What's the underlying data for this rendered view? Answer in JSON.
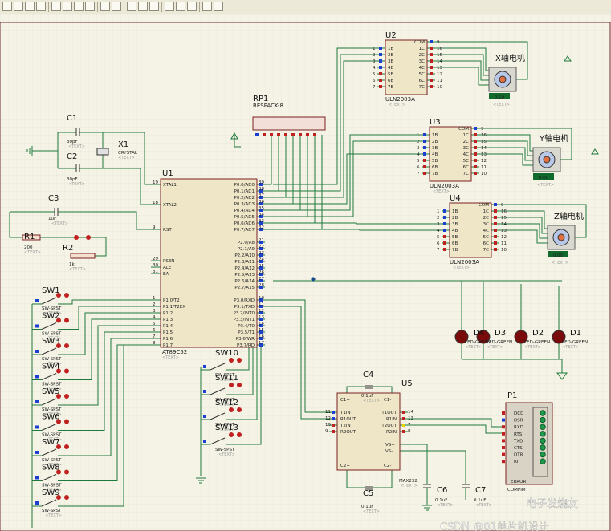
{
  "toolbar": {
    "buttons": [
      "new",
      "open",
      "save",
      "print",
      "zoom-in",
      "zoom-out",
      "zoom-all",
      "pan",
      "undo",
      "redo",
      "cut",
      "copy",
      "paste",
      "find",
      "bom",
      "netlist",
      "library",
      "error-log"
    ]
  },
  "components": {
    "u1": {
      "ref": "U1",
      "type": "AT89C52",
      "text": "<TEXT>",
      "left_pins": [
        {
          "num": "19",
          "name": "XTAL1"
        },
        {
          "num": "18",
          "name": "XTAL2"
        },
        {
          "num": "9",
          "name": "RST"
        },
        {
          "num": "29",
          "name": "PSEN"
        },
        {
          "num": "30",
          "name": "ALE"
        },
        {
          "num": "31",
          "name": "EA"
        },
        {
          "num": "1",
          "name": "P1.0/T2"
        },
        {
          "num": "2",
          "name": "P1.1/T2EX"
        },
        {
          "num": "3",
          "name": "P1.2"
        },
        {
          "num": "4",
          "name": "P1.3"
        },
        {
          "num": "5",
          "name": "P1.4"
        },
        {
          "num": "6",
          "name": "P1.5"
        },
        {
          "num": "7",
          "name": "P1.6"
        },
        {
          "num": "8",
          "name": "P1.7"
        }
      ],
      "right_pins": [
        {
          "num": "39",
          "name": "P0.0/AD0"
        },
        {
          "num": "38",
          "name": "P0.1/AD1"
        },
        {
          "num": "37",
          "name": "P0.2/AD2"
        },
        {
          "num": "36",
          "name": "P0.3/AD3"
        },
        {
          "num": "35",
          "name": "P0.4/AD4"
        },
        {
          "num": "34",
          "name": "P0.5/AD5"
        },
        {
          "num": "33",
          "name": "P0.6/AD6"
        },
        {
          "num": "32",
          "name": "P0.7/AD7"
        },
        {
          "num": "21",
          "name": "P2.0/A8"
        },
        {
          "num": "22",
          "name": "P2.1/A9"
        },
        {
          "num": "23",
          "name": "P2.2/A10"
        },
        {
          "num": "24",
          "name": "P2.3/A11"
        },
        {
          "num": "25",
          "name": "P2.4/A12"
        },
        {
          "num": "26",
          "name": "P2.5/A13"
        },
        {
          "num": "27",
          "name": "P2.6/A14"
        },
        {
          "num": "28",
          "name": "P2.7/A15"
        },
        {
          "num": "10",
          "name": "P3.0/RXD"
        },
        {
          "num": "11",
          "name": "P3.1/TXD"
        },
        {
          "num": "12",
          "name": "P3.2/INT0"
        },
        {
          "num": "13",
          "name": "P3.3/INT1"
        },
        {
          "num": "14",
          "name": "P3.4/T0"
        },
        {
          "num": "15",
          "name": "P3.5/T1"
        },
        {
          "num": "16",
          "name": "P3.6/WR"
        },
        {
          "num": "17",
          "name": "P3.7/RD"
        }
      ]
    },
    "uln": [
      {
        "ref": "U2",
        "type": "ULN2003A",
        "text": "<TEXT>"
      },
      {
        "ref": "U3",
        "type": "ULN2003A",
        "text": "<TEXT>"
      },
      {
        "ref": "U4",
        "type": "ULN2003A",
        "text": "<TEXT>"
      }
    ],
    "uln_left_pins": [
      {
        "num": "1",
        "name": "1B"
      },
      {
        "num": "2",
        "name": "2B"
      },
      {
        "num": "3",
        "name": "3B"
      },
      {
        "num": "4",
        "name": "4B"
      },
      {
        "num": "5",
        "name": "5B"
      },
      {
        "num": "6",
        "name": "6B"
      },
      {
        "num": "7",
        "name": "7B"
      }
    ],
    "uln_right_pins": [
      {
        "num": "9",
        "name": "COM"
      },
      {
        "num": "16",
        "name": "1C"
      },
      {
        "num": "15",
        "name": "2C"
      },
      {
        "num": "14",
        "name": "3C"
      },
      {
        "num": "13",
        "name": "4C"
      },
      {
        "num": "12",
        "name": "5C"
      },
      {
        "num": "11",
        "name": "6C"
      },
      {
        "num": "10",
        "name": "7C"
      }
    ],
    "motors": [
      {
        "label": "X轴电机",
        "readout": "0.10",
        "text": "<TEXT>"
      },
      {
        "label": "Y轴电机",
        "readout": "0.00",
        "text": "<TEXT>"
      },
      {
        "label": "Z轴电机",
        "readout": "0.00",
        "text": "<TEXT>"
      }
    ],
    "rp1": {
      "ref": "RP1",
      "type": "RESPACK-8"
    },
    "c1": {
      "ref": "C1",
      "value": "30pF",
      "text": "<TEXT>"
    },
    "c2": {
      "ref": "C2",
      "value": "30pF",
      "text": "<TEXT>"
    },
    "x1": {
      "ref": "X1",
      "type": "CRYSTAL",
      "text": "<TEXT>"
    },
    "c3": {
      "ref": "C3",
      "value": "1uF",
      "text": "<TEXT>"
    },
    "r1": {
      "ref": "R1",
      "value": "200",
      "text": "<TEXT>"
    },
    "r2": {
      "ref": "R2",
      "value": "1k",
      "text": "<TEXT>"
    },
    "switches_left": [
      {
        "ref": "SW1",
        "type": "SW-SPST",
        "text": "<TEXT>"
      },
      {
        "ref": "SW2",
        "type": "SW-SPST",
        "text": "<TEXT>"
      },
      {
        "ref": "SW3",
        "type": "SW-SPST",
        "text": "<TEXT>"
      },
      {
        "ref": "SW4",
        "type": "SW-SPST",
        "text": "<TEXT>"
      },
      {
        "ref": "SW5",
        "type": "SW-SPST",
        "text": "<TEXT>"
      },
      {
        "ref": "SW6",
        "type": "SW-SPST",
        "text": "<TEXT>"
      },
      {
        "ref": "SW7",
        "type": "SW-SPST",
        "text": "<TEXT>"
      },
      {
        "ref": "SW8",
        "type": "SW-SPST",
        "text": "<TEXT>"
      },
      {
        "ref": "SW9",
        "type": "SW-SPST",
        "text": "<TEXT>"
      }
    ],
    "switches_mid": [
      {
        "ref": "SW10",
        "type": "SW-SPST",
        "text": "<TEXT>"
      },
      {
        "ref": "SW11",
        "type": "SW-SPST",
        "text": "<TEXT>"
      },
      {
        "ref": "SW12",
        "type": "SW-SPST",
        "text": "<TEXT>"
      },
      {
        "ref": "SW13",
        "type": "SW-SPST",
        "text": "<TEXT>"
      }
    ],
    "leds": [
      {
        "ref": "D4",
        "type": "LED-GREEN",
        "text": "<TEXT>"
      },
      {
        "ref": "D3",
        "type": "LED-GREEN",
        "text": "<TEXT>"
      },
      {
        "ref": "D2",
        "type": "LED-GREEN",
        "text": "<TEXT>"
      },
      {
        "ref": "D1",
        "type": "LED-GREEN",
        "text": "<TEXT>"
      }
    ],
    "u5": {
      "ref": "U5",
      "type": "MAX232",
      "text": "<TEXT>",
      "left_pins": [
        {
          "num": "11",
          "name": "T1IN"
        },
        {
          "num": "12",
          "name": "R1OUT"
        },
        {
          "num": "10",
          "name": "T2IN"
        },
        {
          "num": "9",
          "name": "R2OUT"
        }
      ],
      "right_pins": [
        {
          "num": "14",
          "name": "T1OUT"
        },
        {
          "num": "13",
          "name": "R1IN"
        },
        {
          "num": "7",
          "name": "T2OUT"
        },
        {
          "num": "8",
          "name": "R2IN"
        }
      ],
      "top_left": "C1+",
      "top_right": "C1-",
      "bottom_left": "C2+",
      "bottom_right": "C2-",
      "vs_plus": "VS+",
      "vs_minus": "VS-"
    },
    "c4": {
      "ref": "C4",
      "value": "0.1uF",
      "text": "<TEXT>"
    },
    "c5": {
      "ref": "C5",
      "value": "0.1uF",
      "text": "<TEXT>"
    },
    "c6": {
      "ref": "C6",
      "value": "0.1uF",
      "text": "<TEXT>"
    },
    "c7": {
      "ref": "C7",
      "value": "0.1uF",
      "text": "<TEXT>"
    },
    "p1": {
      "ref": "P1",
      "type": "COMPIM",
      "error": "ERROR",
      "pins": [
        "DCD",
        "DSR",
        "RXD",
        "RTS",
        "TXD",
        "CTS",
        "DTR",
        "RI"
      ]
    }
  },
  "watermark": {
    "site": "电子发烧友",
    "credit": "CSDN @01单片机设计"
  }
}
